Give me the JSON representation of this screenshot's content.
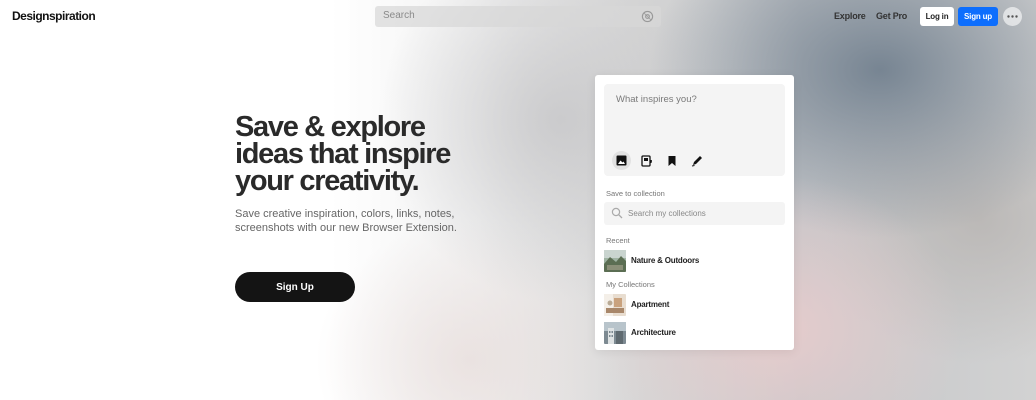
{
  "header": {
    "logo": "Designspiration",
    "search_placeholder": "Search",
    "nav": {
      "explore": "Explore",
      "get_pro": "Get Pro",
      "login": "Log in",
      "signup": "Sign up"
    }
  },
  "hero": {
    "title_lines": [
      "Save & explore",
      "ideas that inspire",
      "your creativity."
    ],
    "subtitle_lines": [
      "Save creative inspiration, colors, links, notes,",
      "screenshots with our new Browser Extension."
    ],
    "cta": "Sign Up"
  },
  "extension_card": {
    "compose_placeholder": "What inspires you?",
    "tools": [
      "image-icon",
      "screenshot-icon",
      "bookmark-icon",
      "pen-icon"
    ],
    "save_to_label": "Save to collection",
    "search_placeholder": "Search my collections",
    "recent_label": "Recent",
    "recent": [
      {
        "name": "Nature & Outdoors"
      }
    ],
    "my_collections_label": "My Collections",
    "collections": [
      {
        "name": "Apartment"
      },
      {
        "name": "Architecture"
      }
    ]
  },
  "colors": {
    "primary_button": "#0d6efd",
    "cta_background": "#141414",
    "text_dark": "#2a2a2a"
  }
}
